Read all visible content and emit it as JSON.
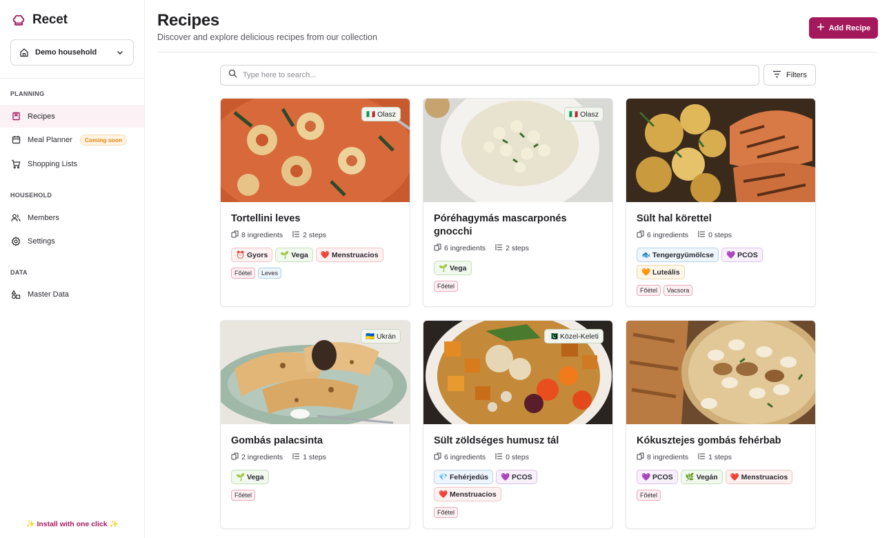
{
  "app": {
    "name": "Recet",
    "household": "Demo household"
  },
  "sidebar": {
    "sections": [
      {
        "title": "PLANNING"
      },
      {
        "title": "HOUSEHOLD"
      },
      {
        "title": "DATA"
      }
    ],
    "items": [
      {
        "label": "Recipes",
        "icon": "book-icon",
        "active": true
      },
      {
        "label": "Meal Planner",
        "icon": "calendar-icon",
        "badge": "Coming soon"
      },
      {
        "label": "Shopping Lists",
        "icon": "cart-icon"
      },
      {
        "label": "Members",
        "icon": "users-icon"
      },
      {
        "label": "Settings",
        "icon": "gear-icon"
      },
      {
        "label": "Master Data",
        "icon": "shapes-icon"
      }
    ],
    "install": "✨ Install with one click ✨"
  },
  "header": {
    "title": "Recipes",
    "subtitle": "Discover and explore delicious recipes from our collection",
    "add_label": "Add Recipe"
  },
  "search": {
    "placeholder": "Type here to search...",
    "value": "",
    "filters_label": "Filters"
  },
  "colors": {
    "accent": "#a3195b"
  },
  "recipes": [
    {
      "title": "Tortellini leves",
      "cuisine": "🇮🇹 Olasz",
      "ingredients": "8 ingredients",
      "steps": "2 steps",
      "tags": [
        {
          "label": "⏰ Gyors"
        },
        {
          "label": "🌱 Vega"
        },
        {
          "label": "❤️ Menstruacios"
        }
      ],
      "categories": [
        {
          "label": "Főétel"
        },
        {
          "label": "Leves"
        }
      ]
    },
    {
      "title": "Póréhagymás mascarponés gnocchi",
      "cuisine": "🇮🇹 Olasz",
      "ingredients": "6 ingredients",
      "steps": "2 steps",
      "tags": [
        {
          "label": "🌱 Vega"
        }
      ],
      "categories": [
        {
          "label": "Főétel"
        }
      ]
    },
    {
      "title": "Sült hal körettel",
      "ingredients": "6 ingredients",
      "steps": "0 steps",
      "tags": [
        {
          "label": "🐟 Tengergyümölcse"
        },
        {
          "label": "💜 PCOS"
        },
        {
          "label": "🧡 Luteális"
        }
      ],
      "categories": [
        {
          "label": "Főétel"
        },
        {
          "label": "Vacsora"
        }
      ]
    },
    {
      "title": "Gombás palacsinta",
      "cuisine": "🇺🇦 Ukrán",
      "ingredients": "2 ingredients",
      "steps": "1 steps",
      "tags": [
        {
          "label": "🌱 Vega"
        }
      ],
      "categories": [
        {
          "label": "Főétel"
        }
      ]
    },
    {
      "title": "Sült zöldséges humusz tál",
      "cuisine": "🇵🇰 Közel-Keleti",
      "ingredients": "6 ingredients",
      "steps": "0 steps",
      "tags": [
        {
          "label": "💎 Fehérjedús"
        },
        {
          "label": "💜 PCOS"
        },
        {
          "label": "❤️ Menstruacios"
        }
      ],
      "categories": [
        {
          "label": "Főétel"
        }
      ]
    },
    {
      "title": "Kókusztejes gombás fehérbab",
      "ingredients": "8 ingredients",
      "steps": "1 steps",
      "tags": [
        {
          "label": "💜 PCOS"
        },
        {
          "label": "🌿 Vegán"
        },
        {
          "label": "❤️ Menstruacios"
        }
      ],
      "categories": [
        {
          "label": "Főétel"
        }
      ]
    }
  ]
}
